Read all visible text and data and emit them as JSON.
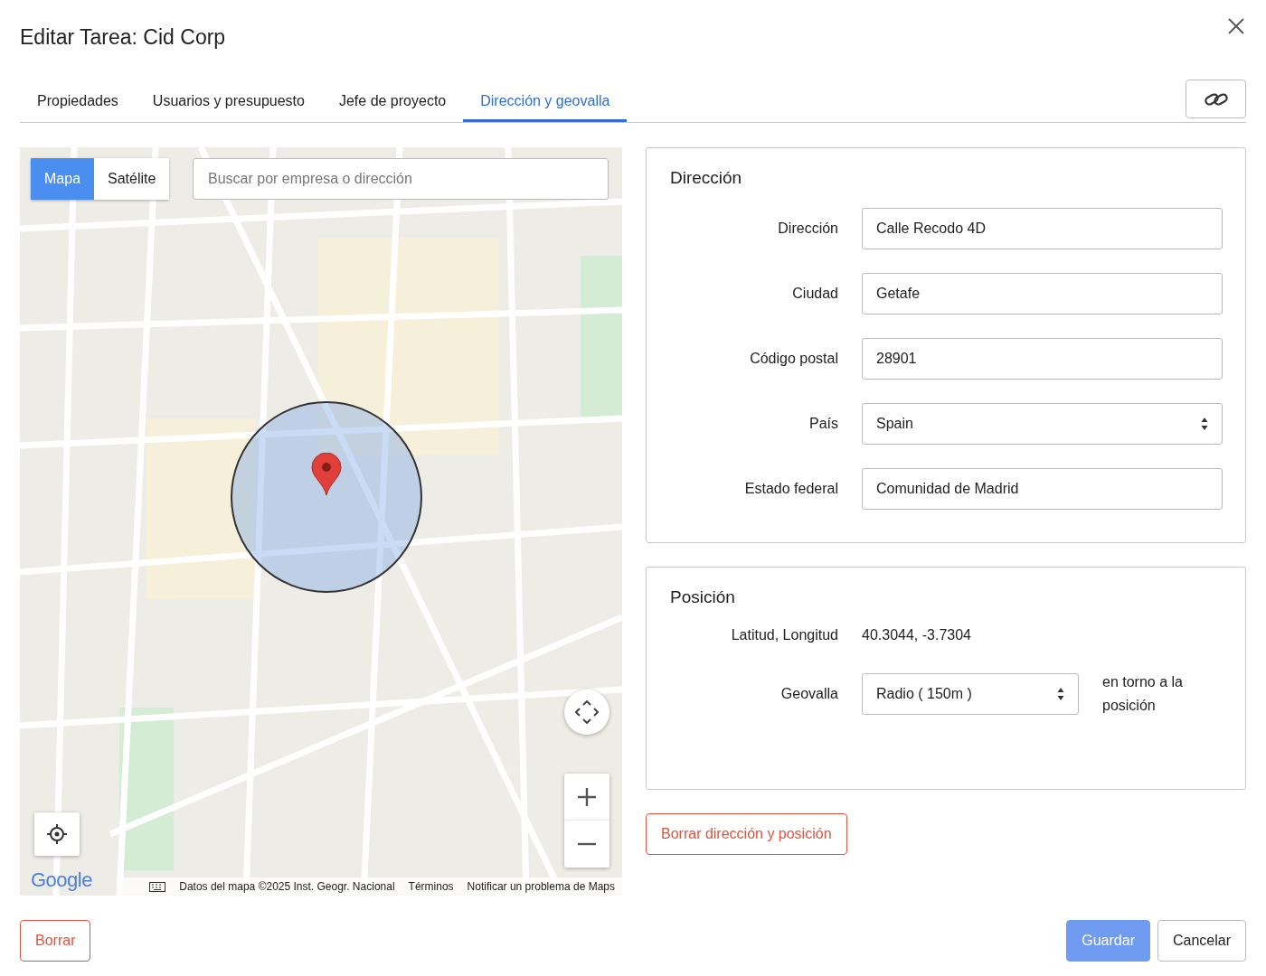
{
  "dialog": {
    "title": "Editar Tarea: Cid Corp"
  },
  "tabs": [
    {
      "label": "Propiedades",
      "selected": false
    },
    {
      "label": "Usuarios y presupuesto",
      "selected": false
    },
    {
      "label": "Jefe de proyecto",
      "selected": false
    },
    {
      "label": "Dirección y geovalla",
      "selected": true
    }
  ],
  "map": {
    "types": [
      {
        "label": "Mapa",
        "selected": true
      },
      {
        "label": "Satélite",
        "selected": false
      }
    ],
    "search": {
      "placeholder": "Buscar por empresa o dirección"
    },
    "logo": "Google",
    "attribution": [
      "Datos del mapa ©2025 Inst. Geogr. Nacional",
      "Términos",
      "Notificar un problema de Maps"
    ]
  },
  "address": {
    "title": "Dirección",
    "fields": [
      {
        "label": "Dirección",
        "value": "Calle Recodo 4D",
        "kind": "text"
      },
      {
        "label": "Ciudad",
        "value": "Getafe",
        "kind": "text"
      },
      {
        "label": "Código postal",
        "value": "28901",
        "kind": "text"
      },
      {
        "label": "País",
        "value": "Spain",
        "kind": "select"
      },
      {
        "label": "Estado federal",
        "value": "Comunidad de Madrid",
        "kind": "text"
      }
    ]
  },
  "position": {
    "title": "Posición",
    "coords_label": "Latitud, Longitud",
    "coords": "40.3044, -3.7304",
    "geofence_label": "Geovalla",
    "geofence": "Radio ( 150m )",
    "geofence_note": "en torno a la posición"
  },
  "clear_button": "Borrar dirección y posición",
  "footer": {
    "delete": "Borrar",
    "save": "Guardar",
    "cancel": "Cancelar"
  }
}
